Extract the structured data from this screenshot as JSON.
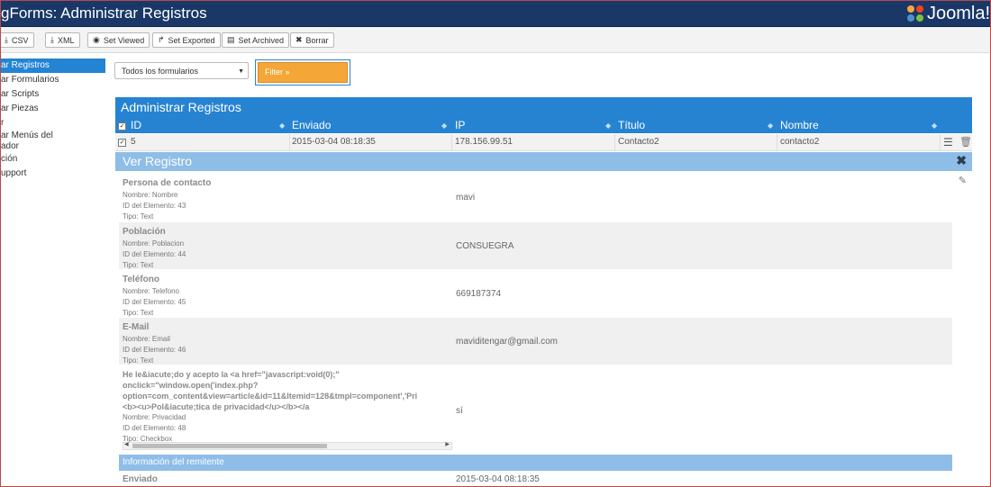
{
  "header": {
    "title": "gForms: Administrar Registros",
    "brand": "Joomla!"
  },
  "toolbar": {
    "buttons": [
      {
        "icon": "download-icon",
        "glyph": "⤓",
        "label": "CSV"
      },
      {
        "icon": "download-icon",
        "glyph": "⤓",
        "label": "XML"
      },
      {
        "icon": "eye-icon",
        "glyph": "◉",
        "label": "Set Viewed"
      },
      {
        "icon": "share-icon",
        "glyph": "↱",
        "label": "Set Exported"
      },
      {
        "icon": "archive-icon",
        "glyph": "▤",
        "label": "Set Archived"
      },
      {
        "icon": "close-icon",
        "glyph": "✖",
        "label": "Borrar"
      }
    ]
  },
  "sidebar": {
    "items": [
      {
        "label": "ar Registros",
        "active": true
      },
      {
        "label": "ar Formularios"
      },
      {
        "label": "ar Scripts"
      },
      {
        "label": "ar Piezas"
      },
      {
        "label": "r"
      },
      {
        "label": "ar Menús del\nador"
      },
      {
        "label": "ción"
      },
      {
        "label": "upport"
      }
    ]
  },
  "filters": {
    "form_select": "Todos los formularios",
    "filter_button": "Filter »"
  },
  "grid": {
    "panel_title": "Administrar Registros",
    "columns": [
      "ID",
      "Enviado",
      "IP",
      "Título",
      "Nombre"
    ],
    "rows": [
      {
        "id": "5",
        "enviado": "2015-03-04 08:18:35",
        "ip": "178.156.99.51",
        "titulo": "Contacto2",
        "nombre": "contacto2"
      }
    ]
  },
  "viewer": {
    "title": "Ver Registro",
    "fields": [
      {
        "label": "Persona de contacto",
        "name": "Nombre: Nombre",
        "element_id": "ID del Elemento: 43",
        "type": "Tipo: Text",
        "value": "mavi"
      },
      {
        "label": "Población",
        "name": "Nombre: Poblacion",
        "element_id": "ID del Elemento: 44",
        "type": "Tipo: Text",
        "value": "CONSUEGRA"
      },
      {
        "label": "Teléfono",
        "name": "Nombre: Telefono",
        "element_id": "ID del Elemento: 45",
        "type": "Tipo: Text",
        "value": "669187374"
      },
      {
        "label": "E-Mail",
        "name": "Nombre: Email",
        "element_id": "ID del Elemento: 46",
        "type": "Tipo: Text",
        "value": "maviditengar@gmail.com"
      }
    ],
    "checkbox_field": {
      "label": "He le&iacute;do y acepto la <a href=\"javascript:void(0);\"\nonclick=\"window.open('index.php?\noption=com_content&view=article&id=11&Itemid=128&tmpl=component','Pri\n<b><u>Pol&iacute;tica de privacidad</u></b></a",
      "name": "Nombre: Privacidad",
      "element_id": "ID del Elemento: 48",
      "type": "Tipo: Checkbox",
      "value": "sí"
    },
    "sender_section": "Información del remitente",
    "sender_fields": [
      {
        "label": "Enviado",
        "value": "2015-03-04 08:18:35"
      }
    ]
  }
}
